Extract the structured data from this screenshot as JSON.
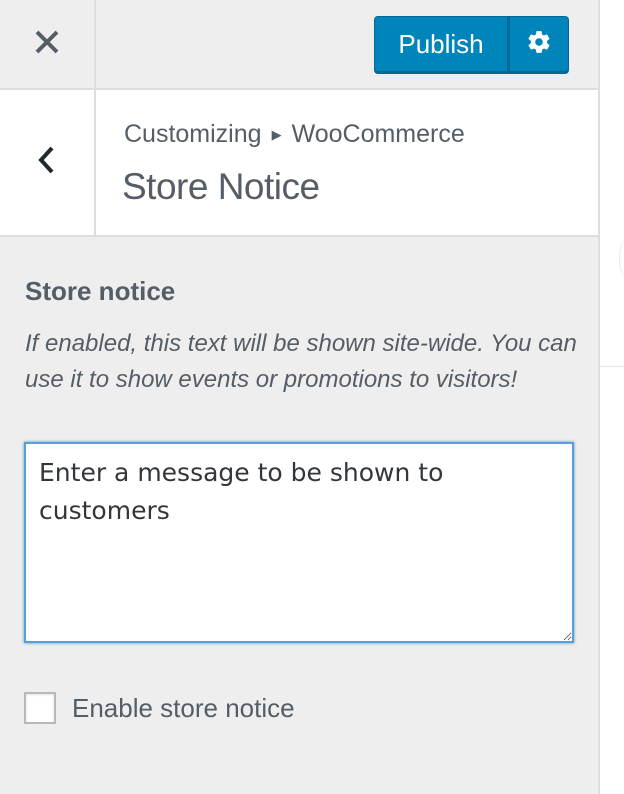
{
  "header": {
    "close_icon": "close-icon",
    "publish_label": "Publish",
    "settings_icon": "gear-icon"
  },
  "section": {
    "back_icon": "chevron-left-icon",
    "breadcrumb_parent": "Customizing",
    "breadcrumb_separator_icon": "triangle-right-icon",
    "breadcrumb_current": "WooCommerce",
    "title": "Store Notice"
  },
  "control": {
    "label": "Store notice",
    "description": "If enabled, this text will be shown site-wide. You can use it to show events or promotions to visitors!",
    "textarea_placeholder": "Enter a message to be shown to customers",
    "textarea_value": ""
  },
  "checkbox": {
    "label": "Enable store notice",
    "checked": false
  },
  "colors": {
    "primary": "#0085ba",
    "panel_bg": "#eeeeee",
    "text": "#555d66",
    "focus_border": "#5b9dd9"
  }
}
